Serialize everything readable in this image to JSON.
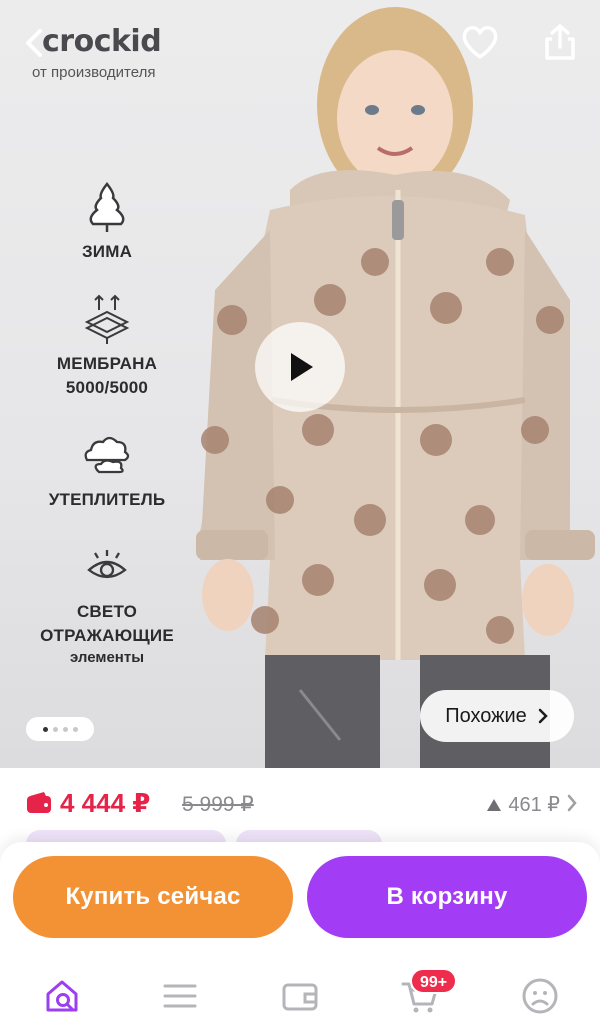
{
  "brand": {
    "name": "crockid",
    "subtitle": "от производителя"
  },
  "features": [
    {
      "icon": "snow-tree-icon",
      "label": "ЗИМА",
      "sub": ""
    },
    {
      "icon": "membrane-icon",
      "label": "МЕМБРАНА",
      "label2": "5000/5000",
      "sub": ""
    },
    {
      "icon": "clouds-icon",
      "label": "УТЕПЛИТЕЛЬ",
      "sub": ""
    },
    {
      "icon": "eye-icon",
      "label": "СВЕТО",
      "label2": "ОТРАЖАЮЩИЕ",
      "sub": "элементы"
    }
  ],
  "gallery": {
    "total_pages": 4,
    "current_page": 1
  },
  "similar_label": "Похожие",
  "price": {
    "current": "4 444 ₽",
    "old": "5 999 ₽",
    "alt": "461 ₽"
  },
  "actions": {
    "buy_now": "Купить сейчас",
    "add_to_cart": "В корзину"
  },
  "tabbar": {
    "cart_badge": "99+"
  },
  "colors": {
    "price": "#e6244a",
    "buy": "#f39234",
    "cart": "#a33df5",
    "accent": "#9b3ff0"
  }
}
